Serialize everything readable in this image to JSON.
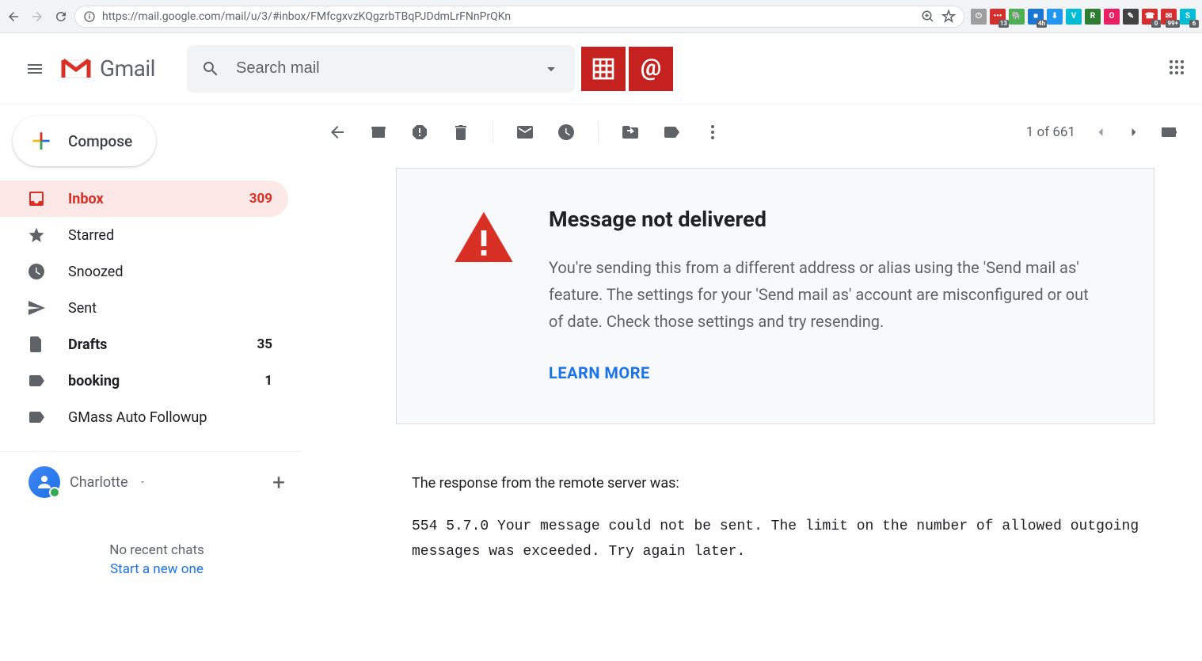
{
  "browser": {
    "url": "https://mail.google.com/mail/u/3/#inbox/FMfcgxvzKQgzrbTBqPJDdmLrFNnPrQKn",
    "extensions": [
      {
        "bg": "#9e9e9e",
        "text": "⏻"
      },
      {
        "bg": "#d32f2f",
        "text": "•••",
        "badge": "13"
      },
      {
        "bg": "#4caf50",
        "text": "🐘"
      },
      {
        "bg": "#1976d2",
        "text": "■",
        "badge": "4h"
      },
      {
        "bg": "#2196f3",
        "text": "⬇"
      },
      {
        "bg": "#00bcd4",
        "text": "V"
      },
      {
        "bg": "#2e7d32",
        "text": "R"
      },
      {
        "bg": "#e91e63",
        "text": "O"
      },
      {
        "bg": "#424242",
        "text": "✎"
      },
      {
        "bg": "#d32f2f",
        "text": "☎",
        "badge": "0"
      },
      {
        "bg": "#d32f2f",
        "text": "✉",
        "badge": "99+"
      },
      {
        "bg": "#00bcd4",
        "text": "S",
        "badge": "6"
      }
    ]
  },
  "header": {
    "brand": "Gmail",
    "search_placeholder": "Search mail"
  },
  "sidebar": {
    "compose": "Compose",
    "items": [
      {
        "icon": "inbox",
        "label": "Inbox",
        "count": "309",
        "active": true
      },
      {
        "icon": "star",
        "label": "Starred"
      },
      {
        "icon": "clock",
        "label": "Snoozed"
      },
      {
        "icon": "send",
        "label": "Sent"
      },
      {
        "icon": "file",
        "label": "Drafts",
        "count": "35",
        "bold": true
      },
      {
        "icon": "label",
        "label": "booking",
        "count": "1",
        "bold": true
      },
      {
        "icon": "label",
        "label": "GMass Auto Followup"
      }
    ],
    "hangouts": {
      "user": "Charlotte",
      "empty": "No recent chats",
      "start": "Start a new one"
    }
  },
  "toolbar": {
    "pagination": "1 of 661"
  },
  "message": {
    "title": "Message not delivered",
    "body": "You're sending this from a different address or alias using the 'Send mail as' feature. The settings for your 'Send mail as' account are misconfigured or out of date. Check those settings and try resending.",
    "learn_more": "LEARN MORE",
    "response_label": "The response from the remote server was:",
    "response_code": "554 5.7.0 Your message could not be sent. The limit on the number of allowed outgoing messages was exceeded. Try again later."
  }
}
